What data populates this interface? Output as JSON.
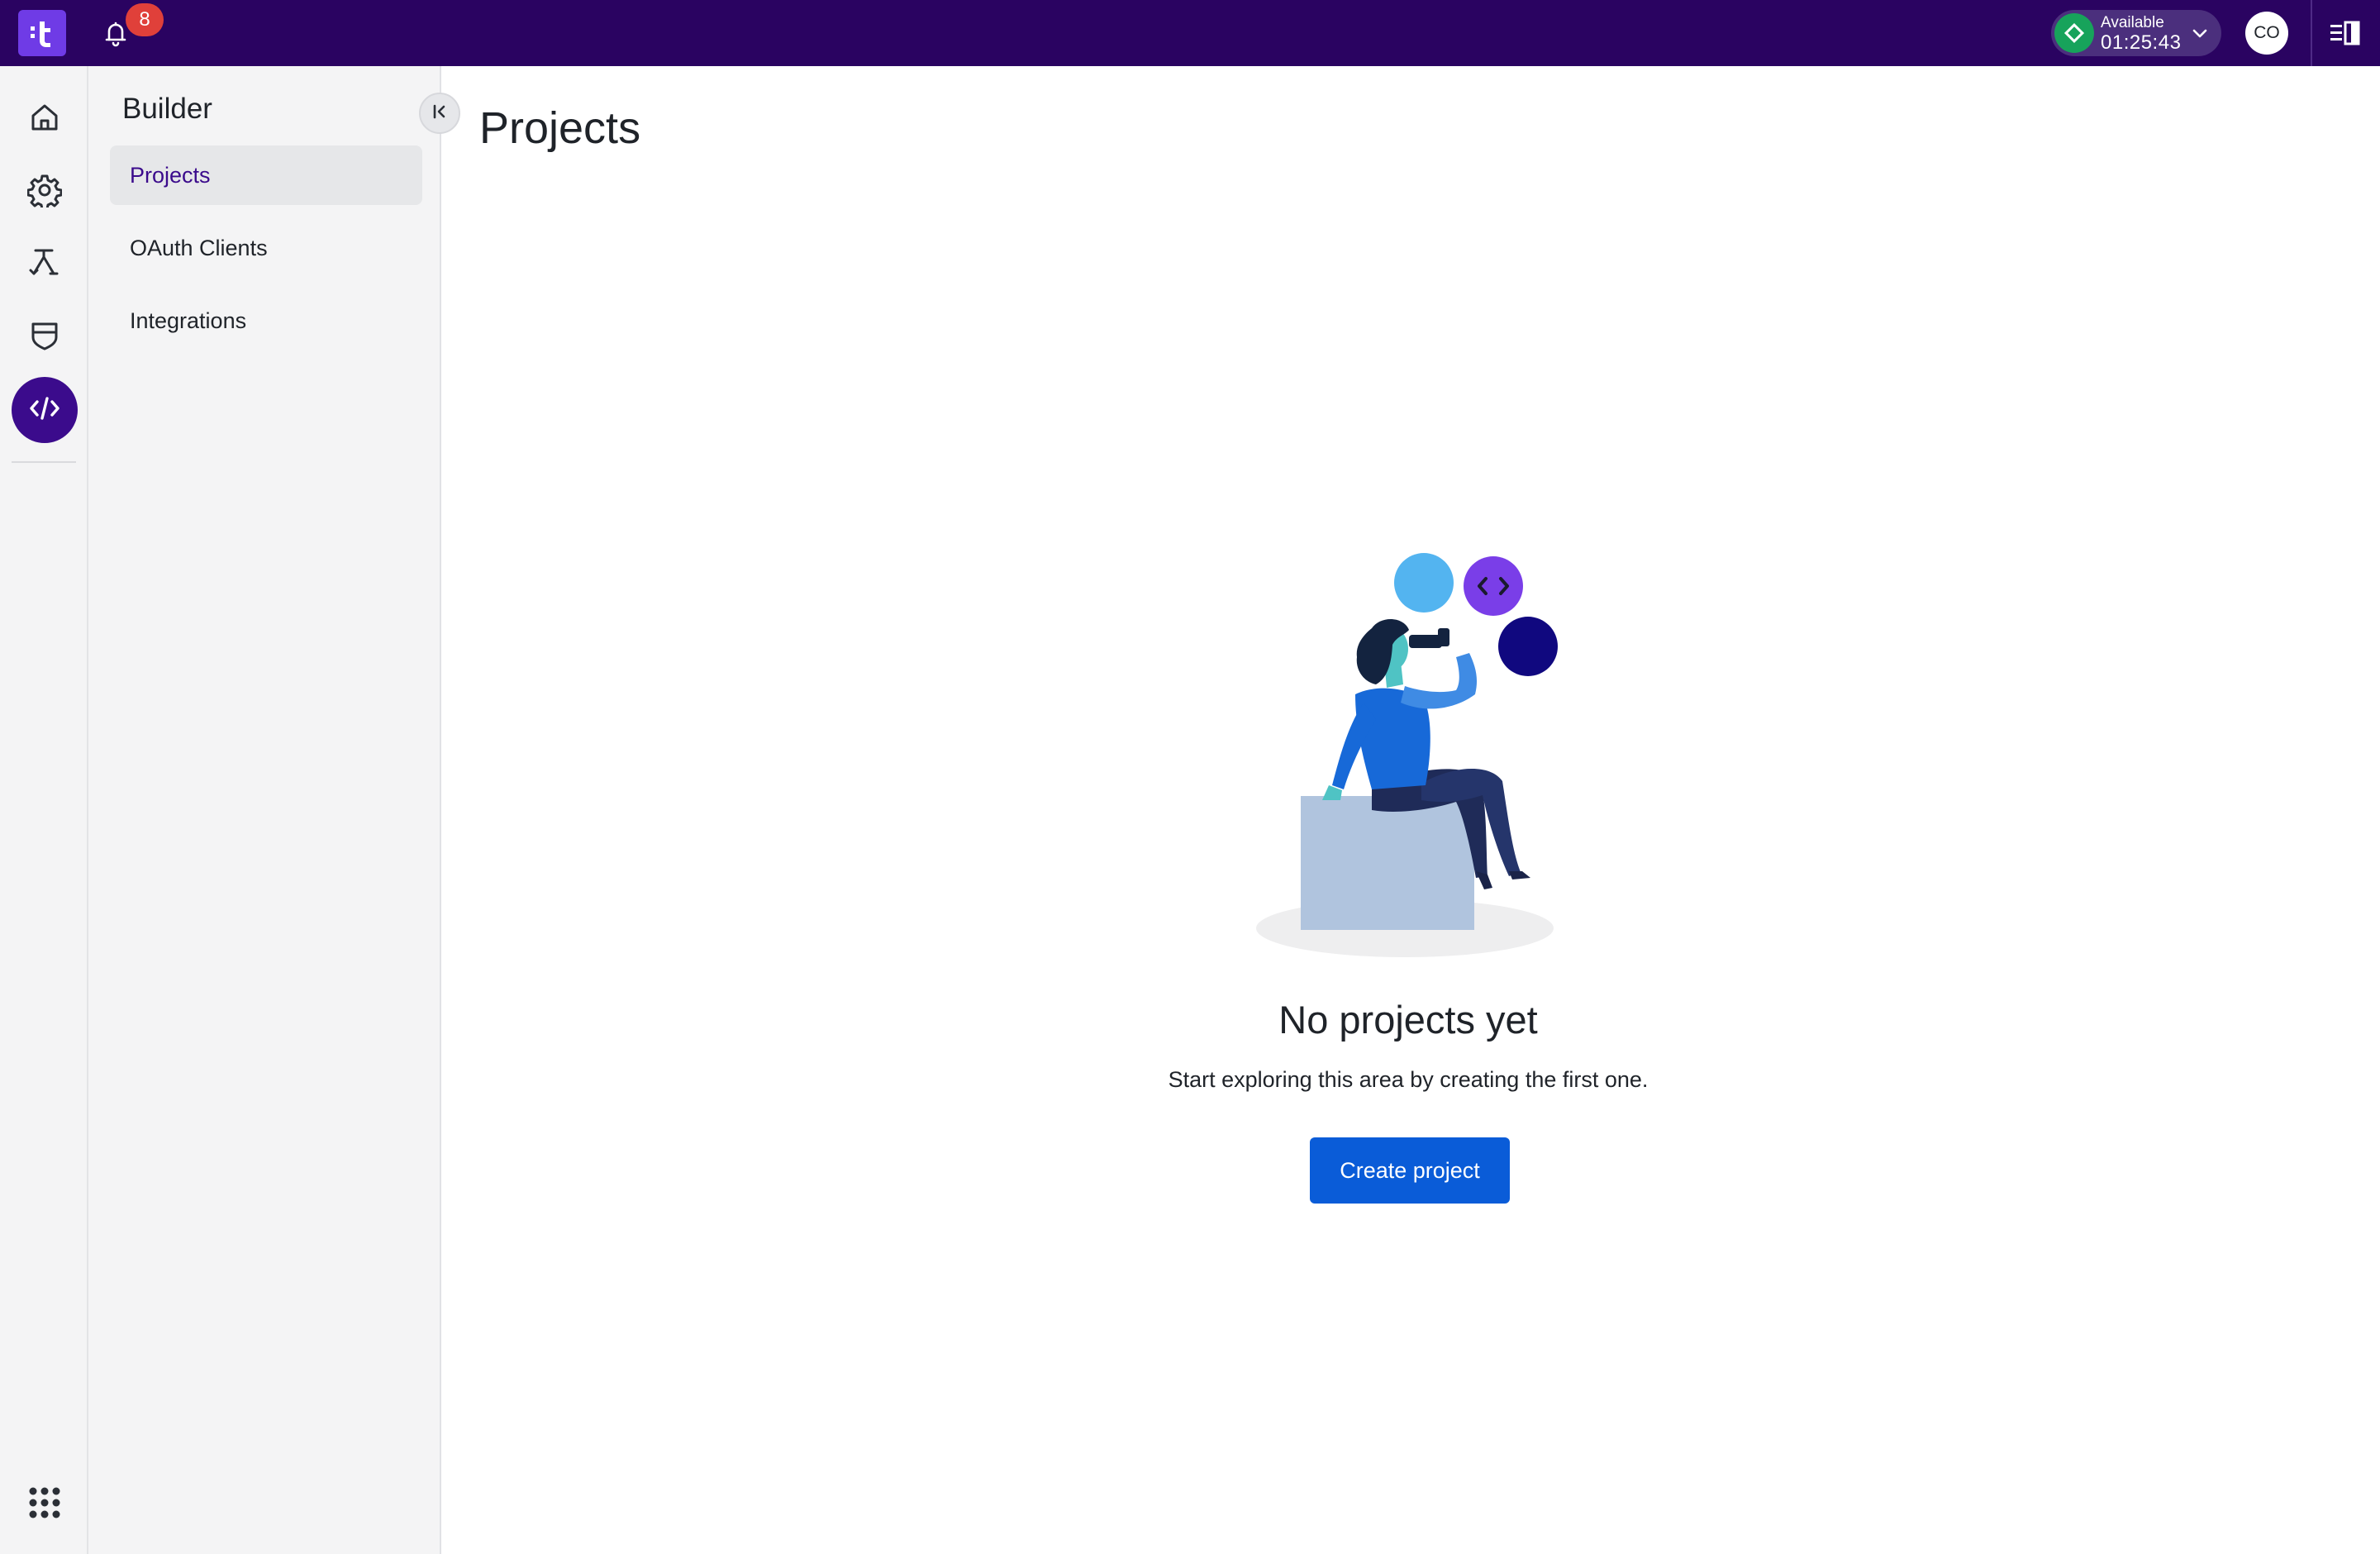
{
  "topbar": {
    "notifications_count": "8",
    "status_label": "Available",
    "status_time": "01:25:43",
    "avatar_initials": "CO"
  },
  "rail": {
    "items": [
      {
        "icon": "home-icon",
        "active": false
      },
      {
        "icon": "gear-icon",
        "active": false
      },
      {
        "icon": "routing-icon",
        "active": false
      },
      {
        "icon": "shield-icon",
        "active": false
      },
      {
        "icon": "code-icon",
        "active": true
      }
    ],
    "bottom_icon": "apps-grid-icon"
  },
  "subnav": {
    "title": "Builder",
    "items": [
      {
        "label": "Projects",
        "active": true
      },
      {
        "label": "OAuth Clients",
        "active": false
      },
      {
        "label": "Integrations",
        "active": false
      }
    ]
  },
  "main": {
    "title": "Projects",
    "empty_title": "No projects yet",
    "empty_subtitle": "Start exploring this area by creating the first one.",
    "create_button": "Create project"
  },
  "colors": {
    "topbar": "#2a0361",
    "brand": "#6f3be6",
    "active_rail": "#3b0b8c",
    "primary_button": "#0a5cd8",
    "status_available": "#17a35b",
    "badge": "#e0403a"
  }
}
